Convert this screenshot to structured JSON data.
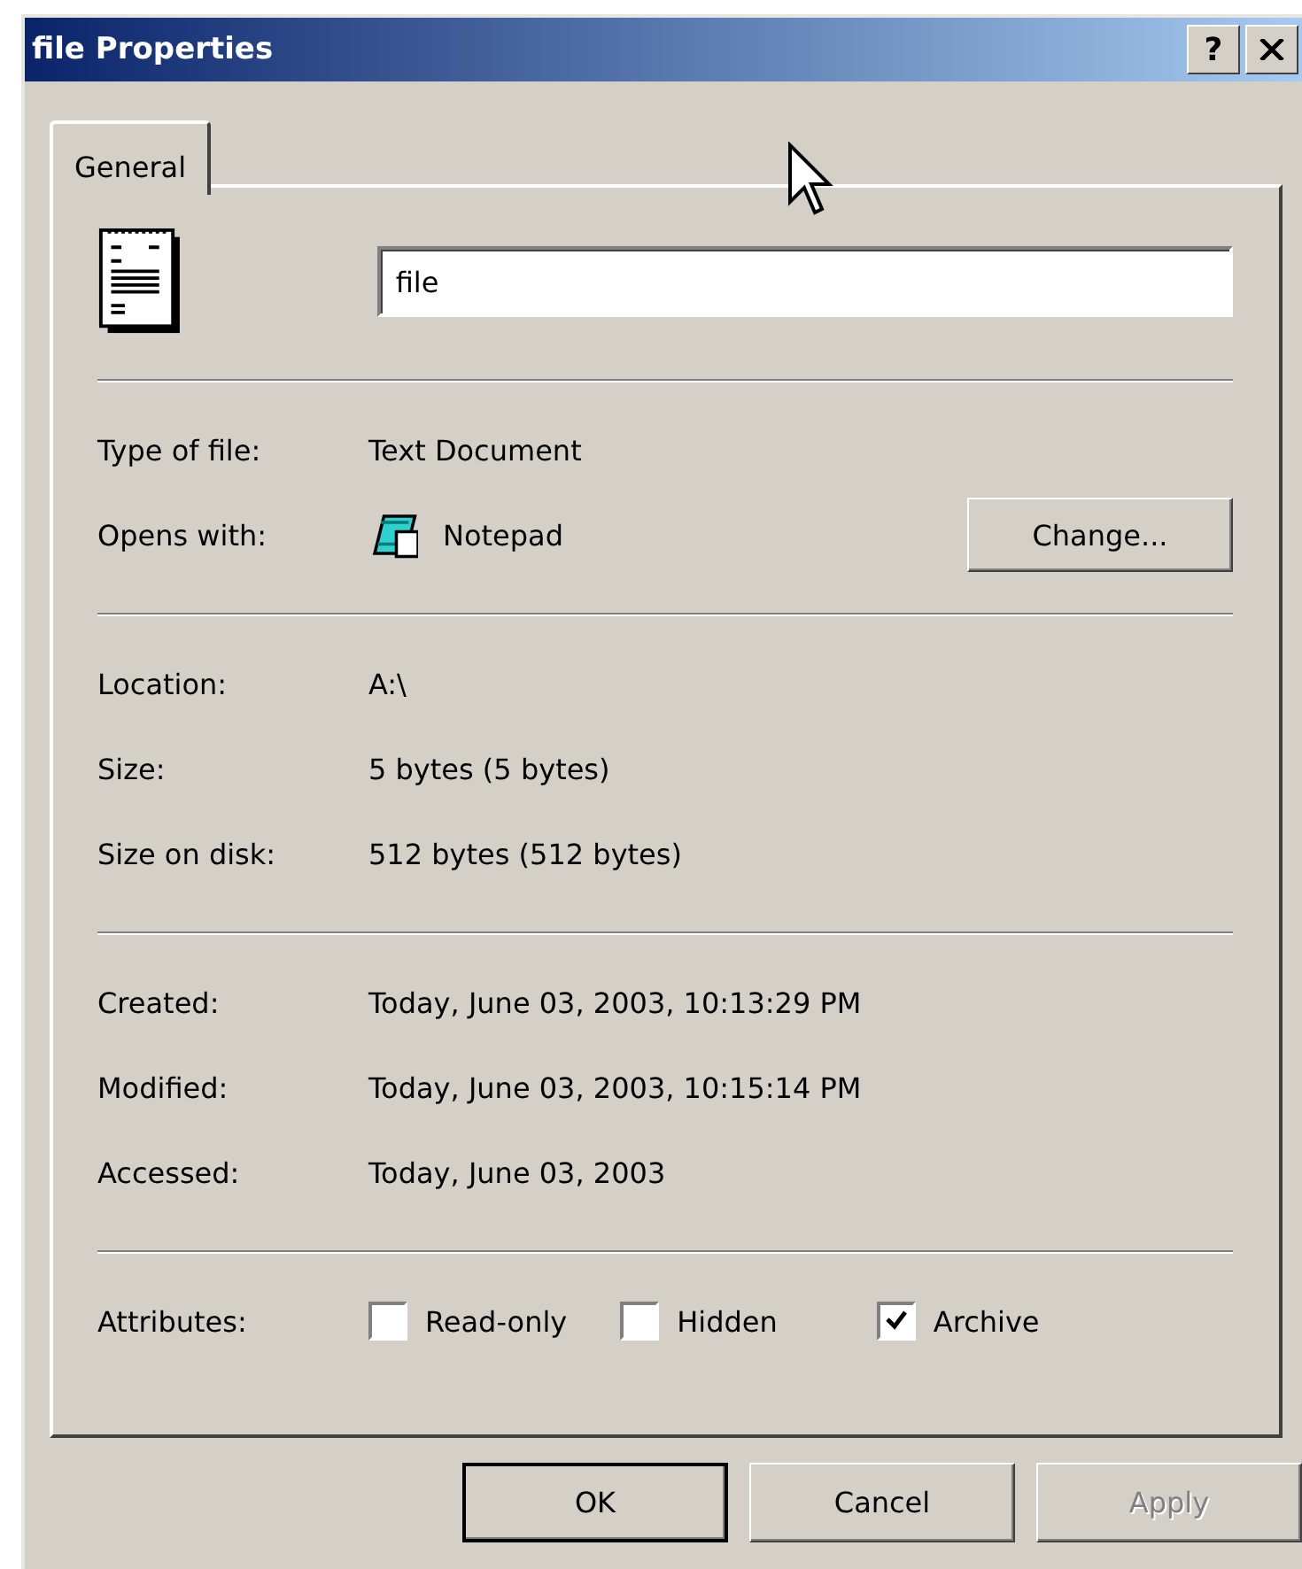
{
  "window": {
    "title": "file Properties",
    "help_button": "?"
  },
  "tabs": [
    {
      "label": "General",
      "selected": true
    }
  ],
  "name_field": {
    "value": "file"
  },
  "sections": [
    [
      {
        "kind": "text",
        "label": "Type of file:",
        "value": "Text Document"
      },
      {
        "kind": "app",
        "label": "Opens with:",
        "value": "Notepad",
        "button": "Change..."
      }
    ],
    [
      {
        "kind": "text",
        "label": "Location:",
        "value": "A:\\"
      },
      {
        "kind": "text",
        "label": "Size:",
        "value": "5 bytes (5 bytes)"
      },
      {
        "kind": "text",
        "label": "Size on disk:",
        "value": "512 bytes (512 bytes)"
      }
    ],
    [
      {
        "kind": "text",
        "label": "Created:",
        "value": "Today, June 03, 2003, 10:13:29 PM"
      },
      {
        "kind": "text",
        "label": "Modified:",
        "value": "Today, June 03, 2003, 10:15:14 PM"
      },
      {
        "kind": "text",
        "label": "Accessed:",
        "value": "Today, June 03, 2003"
      }
    ]
  ],
  "attributes": {
    "label": "Attributes:",
    "options": [
      {
        "label": "Read-only",
        "checked": false
      },
      {
        "label": "Hidden",
        "checked": false
      },
      {
        "label": "Archive",
        "checked": true
      }
    ]
  },
  "buttons": [
    {
      "label": "OK",
      "default": true,
      "disabled": false
    },
    {
      "label": "Cancel",
      "default": false,
      "disabled": false
    },
    {
      "label": "Apply",
      "default": false,
      "disabled": true
    }
  ]
}
